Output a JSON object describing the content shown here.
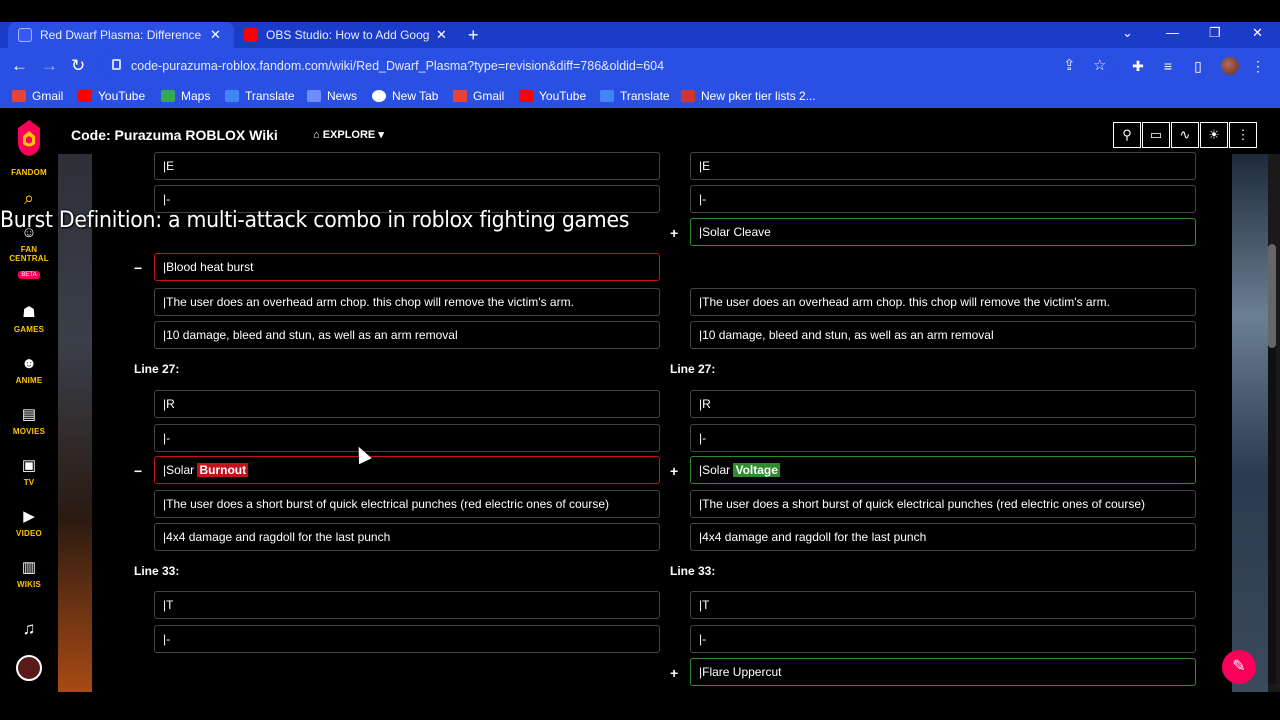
{
  "browser": {
    "tabs": [
      {
        "title": "Red Dwarf Plasma: Difference be",
        "active": true,
        "favicon": "fandom-icon"
      },
      {
        "title": "OBS Studio: How to Add Google",
        "active": false,
        "favicon": "youtube-icon"
      }
    ],
    "url": "code-purazuma-roblox.fandom.com/wiki/Red_Dwarf_Plasma?type=revision&diff=786&oldid=604",
    "bookmarks": [
      "Gmail",
      "YouTube",
      "Maps",
      "Translate",
      "News",
      "New Tab",
      "Gmail",
      "YouTube",
      "Translate",
      "New pker tier lists 2..."
    ]
  },
  "fandom_sidebar": {
    "brand": "FANDOM",
    "fan_central": "FAN CENTRAL",
    "beta": "BETA",
    "items": [
      "GAMES",
      "ANIME",
      "MOVIES",
      "TV",
      "VIDEO",
      "WIKIS"
    ]
  },
  "wiki": {
    "title": "Code: Purazuma ROBLOX Wiki",
    "explore": "EXPLORE"
  },
  "caption": "Burst Definition: a multi-attack combo in roblox fighting games",
  "diff": {
    "left": {
      "rows": [
        "|E",
        "|-",
        "|Blood heat burst",
        "|The user does an overhead arm chop. this chop will remove the victim's arm.",
        "|10 damage, bleed and stun, as well as an arm removal"
      ],
      "line27": "Line 27:",
      "rows27": [
        "|R",
        "|-"
      ],
      "solar_prefix": "|Solar ",
      "solar_removed": "Burnout",
      "rows27b": [
        "|The user does a short burst of quick electrical punches (red electric ones of course)",
        "|4x4 damage and ragdoll for the last punch"
      ],
      "line33": "Line 33:",
      "rows33": [
        "|T",
        "|-"
      ]
    },
    "right": {
      "rows": [
        "|E",
        "|-",
        "|Solar Cleave",
        "|The user does an overhead arm chop. this chop will remove the victim's arm.",
        "|10 damage, bleed and stun, as well as an arm removal"
      ],
      "line27": "Line 27:",
      "rows27": [
        "|R",
        "|-"
      ],
      "solar_prefix": "|Solar ",
      "solar_added": "Voltage",
      "rows27b": [
        "|The user does a short burst of quick electrical punches (red electric ones of course)",
        "|4x4 damage and ragdoll for the last punch"
      ],
      "line33": "Line 33:",
      "rows33": [
        "|T",
        "|-",
        "|Flare Uppercut"
      ]
    },
    "minus": "−",
    "plus": "+"
  },
  "colors": {
    "removed": "#c0131e",
    "added": "#2e8b2e",
    "fandom_yellow": "#ffc500",
    "fandom_pink": "#fa005a"
  }
}
